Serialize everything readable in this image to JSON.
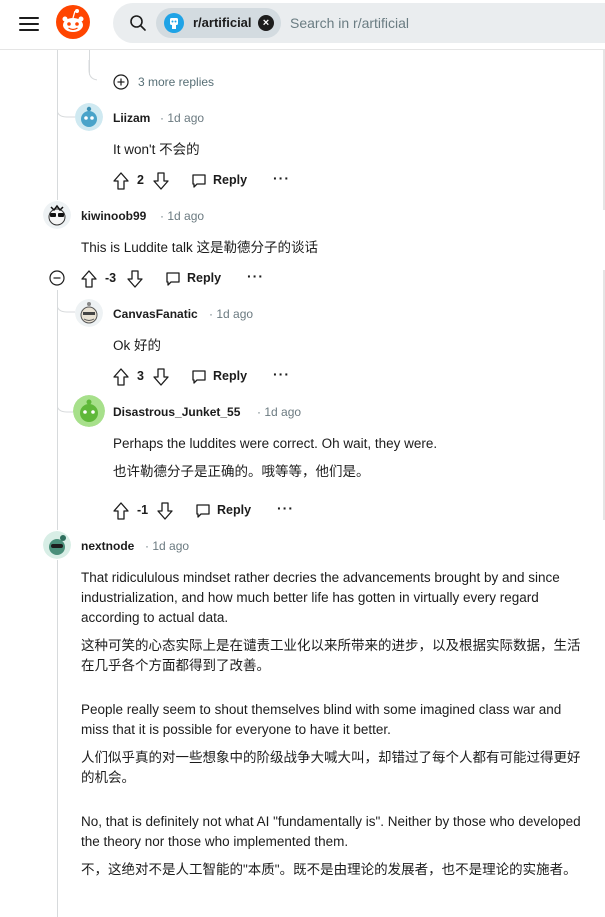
{
  "header": {
    "subreddit_chip": "r/artificial",
    "search_placeholder": "Search in r/artificial"
  },
  "more_replies": "3 more replies",
  "comments": [
    {
      "id": "liizam",
      "username": "Liizam",
      "time": "1d ago",
      "text": [
        "It won't  不会的"
      ],
      "score": "2",
      "reply_label": "Reply",
      "more": "···"
    },
    {
      "id": "kiwinoob99",
      "username": "kiwinoob99",
      "time": "1d ago",
      "text": [
        "This is Luddite talk  这是勒德分子的谈话"
      ],
      "score": "-3",
      "reply_label": "Reply",
      "more": "···"
    },
    {
      "id": "canvasfanatic",
      "username": "CanvasFanatic",
      "time": "1d ago",
      "text": [
        "Ok  好的"
      ],
      "score": "3",
      "reply_label": "Reply",
      "more": "···"
    },
    {
      "id": "disastrous",
      "username": "Disastrous_Junket_55",
      "time": "1d ago",
      "text": [
        "Perhaps the luddites were correct. Oh wait, they were.",
        "也许勒德分子是正确的。哦等等，他们是。"
      ],
      "score": "-1",
      "reply_label": "Reply",
      "more": "···"
    },
    {
      "id": "nextnode",
      "username": "nextnode",
      "time": "1d ago",
      "text": [
        "That ridicululous mindset rather decries the advancements brought by and since industrialization, and how much better life has gotten in virtually every regard according to actual data.",
        "这种可笑的心态实际上是在谴责工业化以来所带来的进步，以及根据实际数据，生活在几乎各个方面都得到了改善。",
        "People really seem to shout themselves blind with some imagined class war and miss that it is possible for everyone to have it better.",
        "人们似乎真的对一些想象中的阶级战争大喊大叫，却错过了每个人都有可能过得更好的机会。",
        "No, that is definitely not what AI \"fundamentally is\". Neither by those who developed the theory nor those who implemented them.",
        "不，这绝对不是人工智能的\"本质\"。既不是由理论的发展者，也不是理论的实施者。"
      ]
    }
  ]
}
